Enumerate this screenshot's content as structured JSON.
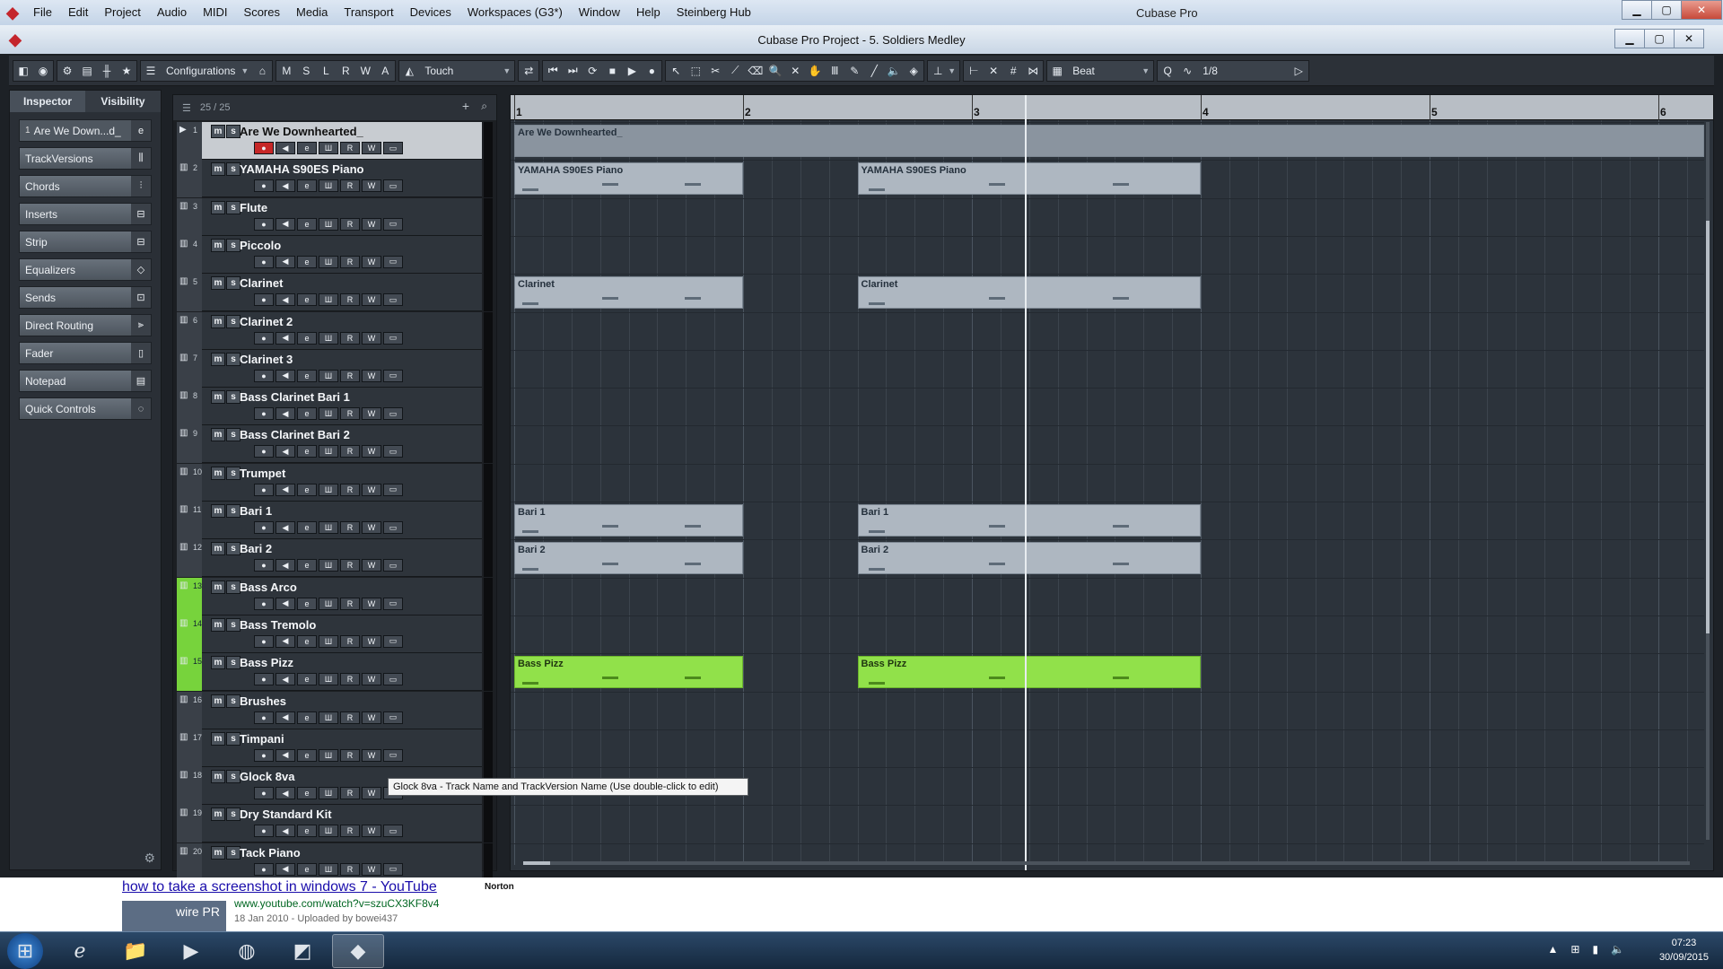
{
  "app": {
    "title": "Cubase Pro",
    "project_title": "Cubase Pro Project - 5. Soldiers Medley",
    "menu": [
      "File",
      "Edit",
      "Project",
      "Audio",
      "MIDI",
      "Scores",
      "Media",
      "Transport",
      "Devices",
      "Workspaces (G3*)",
      "Window",
      "Help",
      "Steinberg Hub"
    ]
  },
  "toolbar": {
    "configurations_label": "Configurations",
    "modes": [
      "M",
      "S",
      "L",
      "R",
      "W",
      "A"
    ],
    "automation_mode": "Touch",
    "snap_type": "Beat",
    "quantize_value": "1/8"
  },
  "inspector": {
    "tabs": [
      "Inspector",
      "Visibility"
    ],
    "track_label": "Are We Down...d_",
    "track_number": "1",
    "sections": [
      "TrackVersions",
      "Chords",
      "Inserts",
      "Strip",
      "Equalizers",
      "Sends",
      "Direct Routing",
      "Fader",
      "Notepad",
      "Quick Controls"
    ]
  },
  "tracklist": {
    "count_label": "25 / 25",
    "buttons": {
      "mute": "m",
      "solo": "s",
      "read": "R",
      "write": "W"
    },
    "tracks": [
      {
        "num": "1",
        "name": "Are We Downhearted_",
        "selected": true,
        "green": false
      },
      {
        "num": "2",
        "name": "YAMAHA S90ES Piano",
        "selected": false,
        "green": false
      },
      {
        "num": "3",
        "name": "Flute",
        "selected": false,
        "green": false
      },
      {
        "num": "4",
        "name": "Piccolo",
        "selected": false,
        "green": false
      },
      {
        "num": "5",
        "name": "Clarinet",
        "selected": false,
        "green": false
      },
      {
        "num": "6",
        "name": "Clarinet 2",
        "selected": false,
        "green": false
      },
      {
        "num": "7",
        "name": "Clarinet 3",
        "selected": false,
        "green": false
      },
      {
        "num": "8",
        "name": "Bass Clarinet Bari 1",
        "selected": false,
        "green": false
      },
      {
        "num": "9",
        "name": "Bass Clarinet Bari 2",
        "selected": false,
        "green": false
      },
      {
        "num": "10",
        "name": "Trumpet",
        "selected": false,
        "green": false
      },
      {
        "num": "11",
        "name": "Bari 1",
        "selected": false,
        "green": false
      },
      {
        "num": "12",
        "name": "Bari 2",
        "selected": false,
        "green": false
      },
      {
        "num": "13",
        "name": "Bass Arco",
        "selected": false,
        "green": true
      },
      {
        "num": "14",
        "name": "Bass Tremolo",
        "selected": false,
        "green": true
      },
      {
        "num": "15",
        "name": "Bass Pizz",
        "selected": false,
        "green": true
      },
      {
        "num": "16",
        "name": "Brushes",
        "selected": false,
        "green": false
      },
      {
        "num": "17",
        "name": "Timpani",
        "selected": false,
        "green": false
      },
      {
        "num": "18",
        "name": "Glock 8va",
        "selected": false,
        "green": false
      },
      {
        "num": "19",
        "name": "Dry Standard Kit",
        "selected": false,
        "green": false
      },
      {
        "num": "20",
        "name": "Tack Piano",
        "selected": false,
        "green": false
      }
    ]
  },
  "tooltip": "Glock 8va - Track Name and TrackVersion Name (Use double-click to edit)",
  "ruler": {
    "bars": [
      "1",
      "2",
      "3",
      "4",
      "5",
      "6"
    ]
  },
  "parts": [
    {
      "track": 1,
      "name": "Are We Downhearted_",
      "start": 1,
      "end": 6.2,
      "kind": "master"
    },
    {
      "track": 2,
      "name": "YAMAHA S90ES Piano",
      "start": 1,
      "end": 2,
      "kind": "normal"
    },
    {
      "track": 2,
      "name": "YAMAHA S90ES Piano",
      "start": 2.5,
      "end": 4,
      "kind": "normal"
    },
    {
      "track": 5,
      "name": "Clarinet",
      "start": 1,
      "end": 2,
      "kind": "normal"
    },
    {
      "track": 5,
      "name": "Clarinet",
      "start": 2.5,
      "end": 4,
      "kind": "normal"
    },
    {
      "track": 11,
      "name": "Bari 1",
      "start": 1,
      "end": 2,
      "kind": "normal"
    },
    {
      "track": 11,
      "name": "Bari 1",
      "start": 2.5,
      "end": 4,
      "kind": "normal"
    },
    {
      "track": 12,
      "name": "Bari 2",
      "start": 1,
      "end": 2,
      "kind": "normal"
    },
    {
      "track": 12,
      "name": "Bari 2",
      "start": 2.5,
      "end": 4,
      "kind": "normal"
    },
    {
      "track": 15,
      "name": "Bass Pizz",
      "start": 1,
      "end": 2,
      "kind": "green"
    },
    {
      "track": 15,
      "name": "Bass Pizz",
      "start": 2.5,
      "end": 4,
      "kind": "green"
    }
  ],
  "cursor_bar": 3.23,
  "browser": {
    "link_text": "how to take a screenshot in windows 7 - YouTube",
    "badge": "Norton",
    "url": "www.youtube.com/watch?v=szuCX3KF8v4",
    "meta": "18 Jan 2010 - Uploaded by bowei437",
    "thumb_text": "wire PR"
  },
  "taskbar": {
    "time": "07:23",
    "date": "30/09/2015"
  }
}
